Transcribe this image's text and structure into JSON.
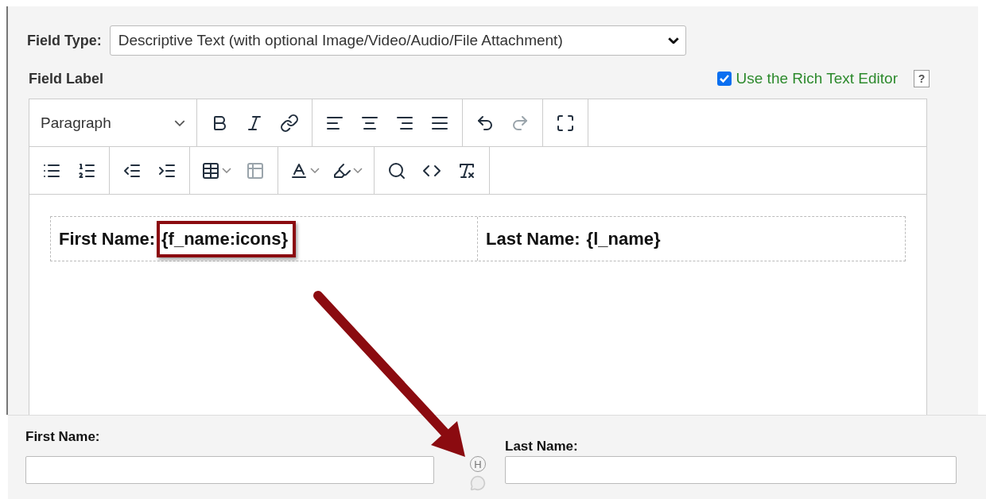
{
  "field_type": {
    "label": "Field Type:",
    "value": "Descriptive Text (with optional Image/Video/Audio/File Attachment)"
  },
  "field_label": {
    "label": "Field Label",
    "rich_text": {
      "label": "Use the Rich Text Editor",
      "checked": true
    },
    "help": "?"
  },
  "toolbar_rows": [
    [
      [
        {
          "kind": "block-format",
          "text": "Paragraph"
        }
      ],
      [
        {
          "kind": "bold",
          "disabled": false
        },
        {
          "kind": "italic",
          "disabled": false
        },
        {
          "kind": "link",
          "disabled": false
        }
      ],
      [
        {
          "kind": "align-left",
          "disabled": false
        },
        {
          "kind": "align-center",
          "disabled": false
        },
        {
          "kind": "align-right",
          "disabled": false
        },
        {
          "kind": "align-justify",
          "disabled": false
        }
      ],
      [
        {
          "kind": "undo",
          "disabled": false
        },
        {
          "kind": "redo",
          "disabled": true
        }
      ],
      [
        {
          "kind": "fullscreen",
          "disabled": false
        }
      ]
    ],
    [
      [
        {
          "kind": "bullet-list",
          "disabled": false
        },
        {
          "kind": "numbered-list",
          "disabled": false
        }
      ],
      [
        {
          "kind": "outdent",
          "disabled": false
        },
        {
          "kind": "indent",
          "disabled": false
        }
      ],
      [
        {
          "kind": "table",
          "disabled": false,
          "caret": true
        },
        {
          "kind": "table-properties",
          "disabled": true
        }
      ],
      [
        {
          "kind": "text-color",
          "disabled": false,
          "caret": true
        },
        {
          "kind": "highlight",
          "disabled": false,
          "caret": true
        }
      ],
      [
        {
          "kind": "find",
          "disabled": false
        },
        {
          "kind": "source-code",
          "disabled": false
        },
        {
          "kind": "clear-formatting",
          "disabled": false
        }
      ]
    ]
  ],
  "content_table": [
    {
      "label": "First Name:",
      "token": "{f_name:icons}",
      "highlighted": true
    },
    {
      "label": "Last Name:",
      "token": "{l_name}",
      "highlighted": false
    }
  ],
  "preview": {
    "first_name": {
      "label": "First Name:"
    },
    "history_badge": "H",
    "last_name": {
      "label": "Last Name:"
    }
  }
}
